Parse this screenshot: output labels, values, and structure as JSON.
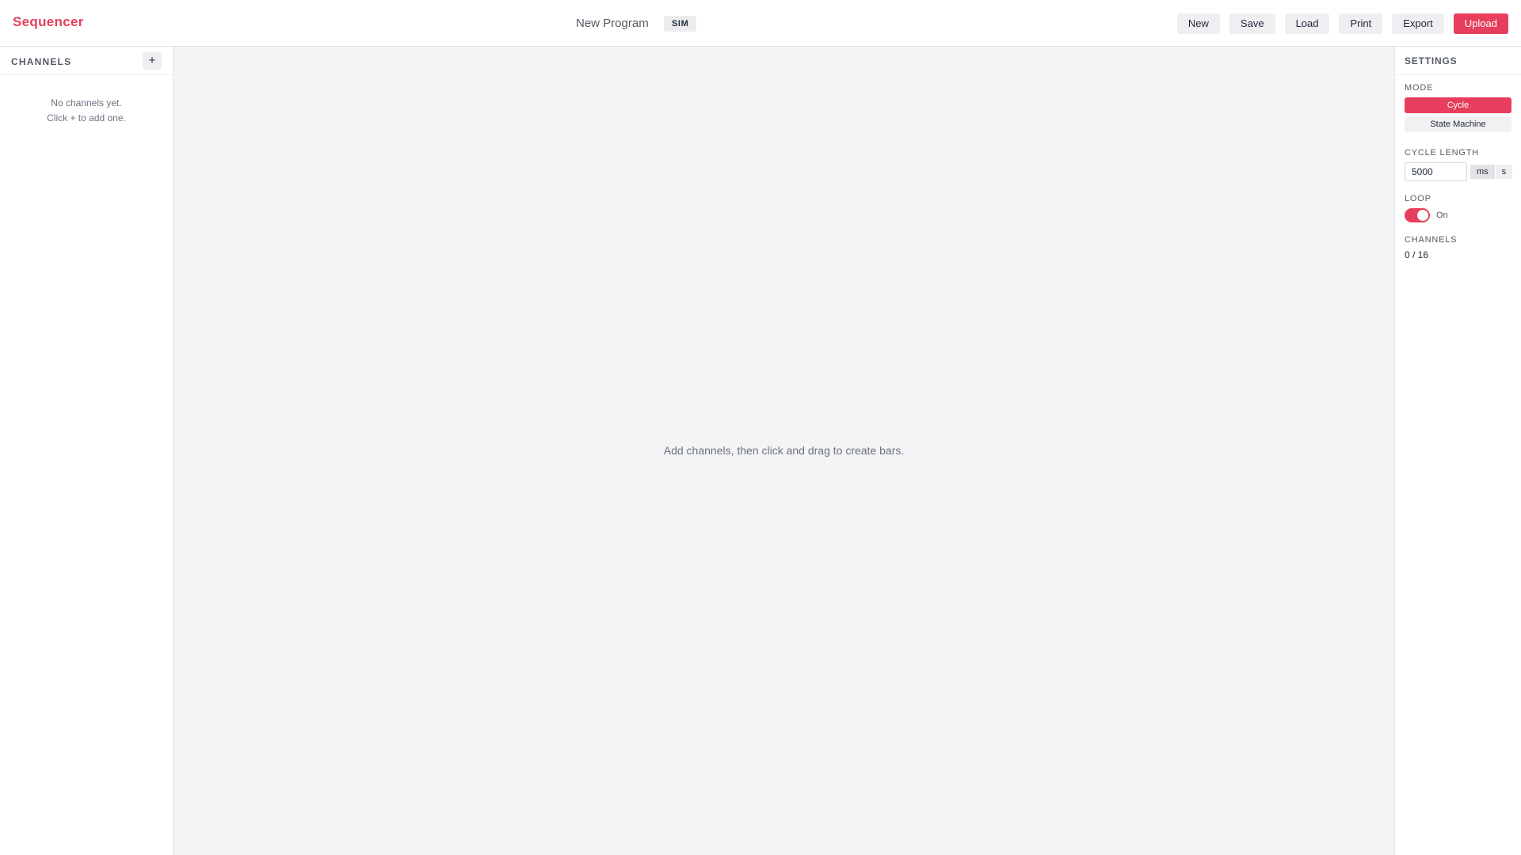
{
  "app": {
    "brand": "Sequencer",
    "program_title": "New Program",
    "badge": "SIM"
  },
  "toolbar": {
    "new_label": "New",
    "save_label": "Save",
    "load_label": "Load",
    "print_label": "Print",
    "export_label": "Export",
    "upload_label": "Upload"
  },
  "sidebar": {
    "title": "CHANNELS",
    "add_label": "+",
    "empty_line1": "No channels yet.",
    "empty_line2": "Click + to add one."
  },
  "canvas": {
    "hint": "Add channels, then click and drag to create bars."
  },
  "settings": {
    "title": "SETTINGS",
    "mode": {
      "label": "MODE",
      "options": [
        "Cycle",
        "State Machine"
      ],
      "selected": "Cycle"
    },
    "cycle_length": {
      "label": "CYCLE LENGTH",
      "value": "5000",
      "units": [
        "ms",
        "s"
      ],
      "selected_unit": "ms"
    },
    "loop": {
      "label": "LOOP",
      "state": "On"
    },
    "channels": {
      "label": "CHANNELS",
      "count": "0 / 16"
    }
  },
  "colors": {
    "accent": "#e63e5c",
    "background": "#f4f4f6",
    "panel": "#ffffff",
    "muted_text": "#6b7280"
  }
}
